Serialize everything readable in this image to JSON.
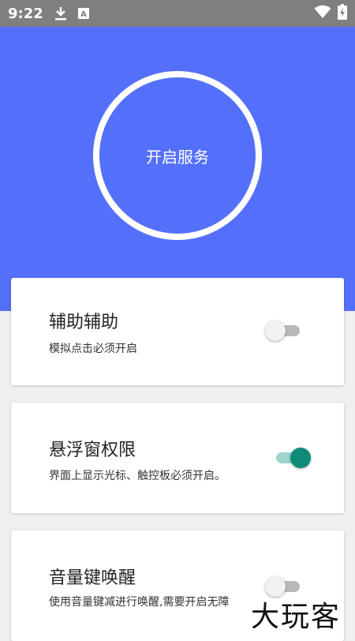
{
  "status_bar": {
    "time": "9:22",
    "download_icon": "download-icon",
    "text_notification_icon": "font-a-icon",
    "wifi_icon": "wifi-icon",
    "battery_icon": "battery-charging-icon",
    "text_notification_glyph": "A"
  },
  "hero": {
    "background_color": "#5470fb",
    "service_button_label": "开启服务"
  },
  "settings": [
    {
      "title": "辅助辅助",
      "subtitle": "模拟点击必须开启",
      "enabled": false
    },
    {
      "title": "悬浮窗权限",
      "subtitle": "界面上显示光标、触控板必须开启。",
      "enabled": true
    },
    {
      "title": "音量键唤醒",
      "subtitle": "使用音量键减进行唤醒,需要开启无障",
      "enabled": false
    }
  ],
  "colors": {
    "accent": "#0e8a79",
    "accent_track": "#9fd3cc"
  },
  "watermark": "大玩客"
}
